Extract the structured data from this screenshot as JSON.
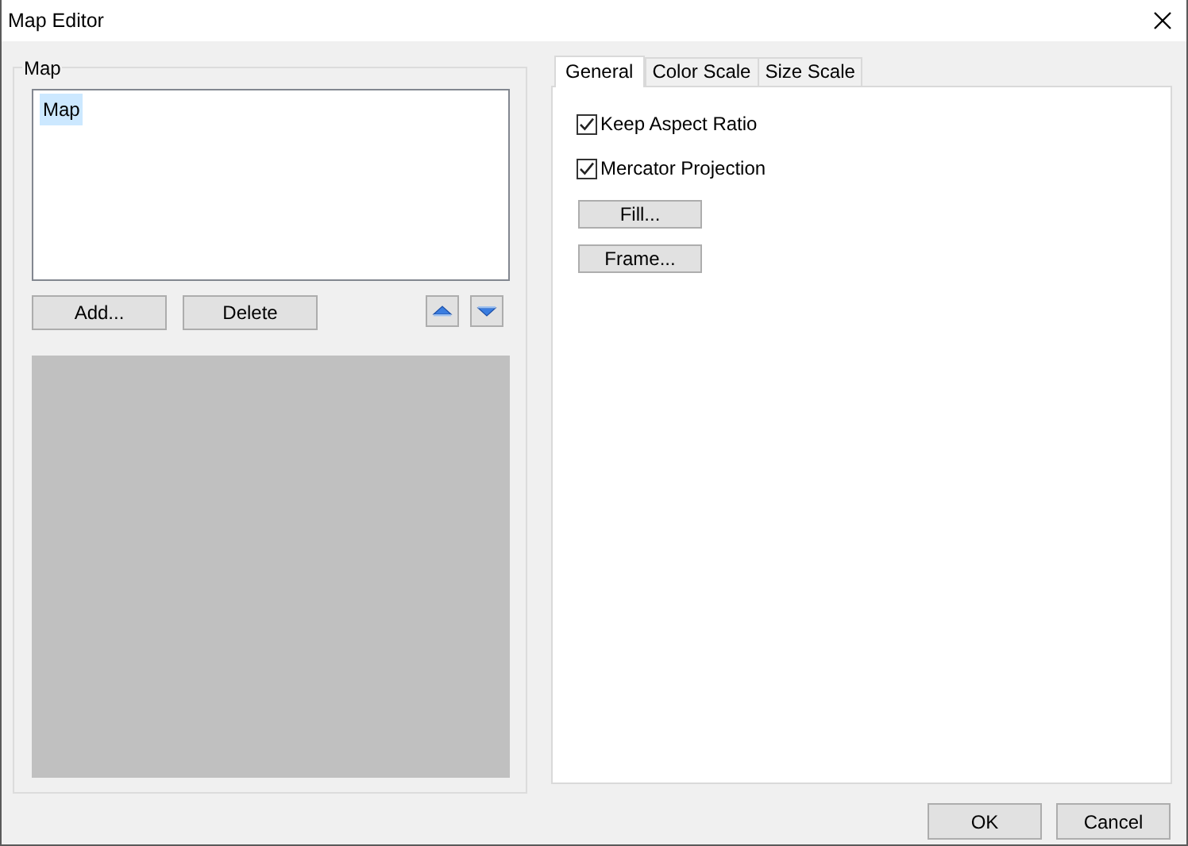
{
  "window": {
    "title": "Map Editor"
  },
  "map_group": {
    "label": "Map",
    "items": [
      {
        "label": "Map",
        "selected": true
      }
    ],
    "buttons": [
      "Add...",
      "Delete"
    ]
  },
  "tabs": [
    {
      "label": "General",
      "selected": true
    },
    {
      "label": "Color Scale",
      "selected": false
    },
    {
      "label": "Size Scale",
      "selected": false
    }
  ],
  "options": [
    {
      "label": "Keep Aspect Ratio",
      "checked": true
    },
    {
      "label": "Mercator Projection",
      "checked": true
    }
  ],
  "tab_buttons": [
    "Fill...",
    "Frame..."
  ],
  "footer_buttons": [
    "OK",
    "Cancel"
  ]
}
